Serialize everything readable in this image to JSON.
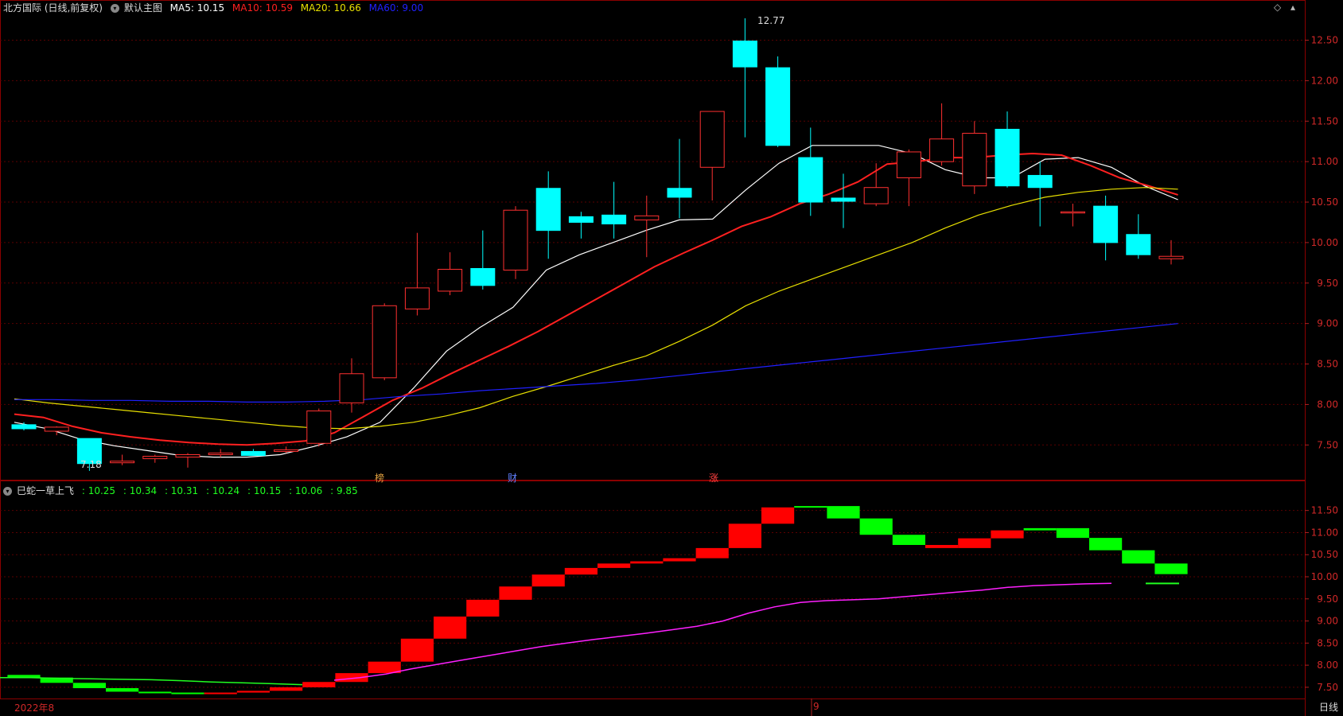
{
  "header": {
    "title": "北方国际 (日线,前复权)",
    "main_label": "默认主图",
    "ma5": "MA5: 10.15",
    "ma10": "MA10: 10.59",
    "ma20": "MA20: 10.66",
    "ma60": "MA60: 9.00",
    "colors": {
      "ma5": "#ffffff",
      "ma10": "#ff2020",
      "ma20": "#e8e000",
      "ma60": "#2020ff"
    }
  },
  "sub_header": {
    "name": "巳蛇一草上飞",
    "values": [
      ": 10.25",
      ": 10.34",
      ": 10.31",
      ": 10.24",
      ": 10.15",
      ": 10.06",
      ": 9.85"
    ]
  },
  "markers": {
    "high": "12.77",
    "low": "7.18",
    "tags": [
      "榜",
      "财",
      "涨"
    ]
  },
  "footer": {
    "date_start": "2022年8",
    "date_mid": "9",
    "period": "日线"
  },
  "chart_data": [
    {
      "type": "candlestick",
      "title": "北方国际 (日线,前复权)",
      "ylim": [
        7.1,
        12.8
      ],
      "yticks": [
        7.5,
        8.0,
        8.5,
        9.0,
        9.5,
        10.0,
        10.5,
        11.0,
        11.5,
        12.0,
        12.5
      ],
      "candles": [
        {
          "o": 7.75,
          "h": 7.78,
          "l": 7.68,
          "c": 7.7
        },
        {
          "o": 7.67,
          "h": 7.73,
          "l": 7.62,
          "c": 7.72
        },
        {
          "o": 7.58,
          "h": 7.58,
          "l": 7.18,
          "c": 7.27
        },
        {
          "o": 7.28,
          "h": 7.38,
          "l": 7.25,
          "c": 7.3
        },
        {
          "o": 7.33,
          "h": 7.38,
          "l": 7.28,
          "c": 7.36
        },
        {
          "o": 7.35,
          "h": 7.4,
          "l": 7.22,
          "c": 7.38
        },
        {
          "o": 7.38,
          "h": 7.45,
          "l": 7.35,
          "c": 7.4
        },
        {
          "o": 7.42,
          "h": 7.45,
          "l": 7.38,
          "c": 7.37
        },
        {
          "o": 7.42,
          "h": 7.48,
          "l": 7.4,
          "c": 7.44
        },
        {
          "o": 7.52,
          "h": 7.95,
          "l": 7.48,
          "c": 7.92
        },
        {
          "o": 8.02,
          "h": 8.57,
          "l": 7.9,
          "c": 8.38
        },
        {
          "o": 8.33,
          "h": 9.25,
          "l": 8.3,
          "c": 9.22
        },
        {
          "o": 9.18,
          "h": 10.12,
          "l": 9.1,
          "c": 9.44
        },
        {
          "o": 9.4,
          "h": 9.88,
          "l": 9.35,
          "c": 9.67
        },
        {
          "o": 9.68,
          "h": 10.15,
          "l": 9.42,
          "c": 9.47
        },
        {
          "o": 9.66,
          "h": 10.45,
          "l": 9.55,
          "c": 10.4
        },
        {
          "o": 10.67,
          "h": 10.88,
          "l": 9.8,
          "c": 10.15
        },
        {
          "o": 10.32,
          "h": 10.38,
          "l": 10.05,
          "c": 10.25
        },
        {
          "o": 10.34,
          "h": 10.75,
          "l": 10.05,
          "c": 10.23
        },
        {
          "o": 10.28,
          "h": 10.58,
          "l": 9.82,
          "c": 10.33
        },
        {
          "o": 10.67,
          "h": 11.28,
          "l": 10.3,
          "c": 10.56
        },
        {
          "o": 10.93,
          "h": 11.62,
          "l": 10.52,
          "c": 11.62
        },
        {
          "o": 12.49,
          "h": 12.77,
          "l": 11.3,
          "c": 12.17
        },
        {
          "o": 12.16,
          "h": 12.3,
          "l": 11.18,
          "c": 11.2
        },
        {
          "o": 11.05,
          "h": 11.42,
          "l": 10.33,
          "c": 10.5
        },
        {
          "o": 10.55,
          "h": 10.85,
          "l": 10.18,
          "c": 10.51
        },
        {
          "o": 10.48,
          "h": 10.98,
          "l": 10.45,
          "c": 10.68
        },
        {
          "o": 10.8,
          "h": 11.15,
          "l": 10.45,
          "c": 11.12
        },
        {
          "o": 11.0,
          "h": 11.72,
          "l": 10.95,
          "c": 11.28
        },
        {
          "o": 10.7,
          "h": 11.5,
          "l": 10.6,
          "c": 11.35
        },
        {
          "o": 11.4,
          "h": 11.62,
          "l": 10.68,
          "c": 10.7
        },
        {
          "o": 10.83,
          "h": 11.0,
          "l": 10.2,
          "c": 10.68
        },
        {
          "o": 10.38,
          "h": 10.48,
          "l": 10.2,
          "c": 10.38
        },
        {
          "o": 10.45,
          "h": 10.58,
          "l": 9.78,
          "c": 10.0
        },
        {
          "o": 10.1,
          "h": 10.35,
          "l": 9.8,
          "c": 9.85
        },
        {
          "o": 9.8,
          "h": 10.03,
          "l": 9.73,
          "c": 9.83
        }
      ],
      "series": [
        {
          "name": "MA5",
          "color": "#ffffff",
          "values": [
            7.78,
            7.7,
            7.57,
            7.49,
            7.43,
            7.37,
            7.35,
            7.35,
            7.38,
            7.48,
            7.6,
            7.78,
            8.2,
            8.66,
            8.95,
            9.2,
            9.66,
            9.85,
            10.0,
            10.15,
            10.28,
            10.29,
            10.65,
            10.98,
            11.2,
            11.2,
            11.2,
            11.1,
            10.9,
            10.8,
            10.8,
            11.03,
            11.05,
            10.93,
            10.7,
            10.53
          ]
        },
        {
          "name": "MA10",
          "color": "#ff2020",
          "values": [
            7.88,
            7.84,
            7.73,
            7.65,
            7.6,
            7.56,
            7.53,
            7.51,
            7.5,
            7.52,
            7.55,
            7.65,
            7.85,
            8.05,
            8.2,
            8.38,
            8.55,
            8.72,
            8.9,
            9.1,
            9.3,
            9.5,
            9.7,
            9.87,
            10.03,
            10.2,
            10.32,
            10.48,
            10.6,
            10.75,
            10.97,
            11.0,
            11.05,
            11.05,
            11.08,
            11.1,
            11.08,
            10.95,
            10.8,
            10.7,
            10.59
          ]
        },
        {
          "name": "MA20",
          "color": "#e8e000",
          "values": [
            8.07,
            8.02,
            7.98,
            7.94,
            7.9,
            7.86,
            7.82,
            7.78,
            7.74,
            7.71,
            7.7,
            7.73,
            7.78,
            7.86,
            7.96,
            8.1,
            8.22,
            8.35,
            8.48,
            8.6,
            8.78,
            8.98,
            9.22,
            9.4,
            9.55,
            9.7,
            9.85,
            10.0,
            10.18,
            10.34,
            10.46,
            10.56,
            10.62,
            10.66,
            10.68,
            10.66
          ]
        },
        {
          "name": "MA60",
          "color": "#2020ff",
          "values": [
            8.06,
            8.06,
            8.05,
            8.05,
            8.04,
            8.04,
            8.03,
            8.03,
            8.04,
            8.06,
            8.1,
            8.13,
            8.17,
            8.2,
            8.23,
            8.26,
            8.3,
            8.35,
            8.4,
            8.45,
            8.5,
            8.55,
            8.6,
            8.65,
            8.7,
            8.75,
            8.8,
            8.85,
            8.9,
            8.95,
            9.0
          ]
        }
      ]
    },
    {
      "type": "bar",
      "title": "巳蛇一草上飞",
      "ylim": [
        7.3,
        11.8
      ],
      "yticks": [
        7.5,
        8.0,
        8.5,
        9.0,
        9.5,
        10.0,
        10.5,
        11.0,
        11.5
      ],
      "steps": [
        {
          "a": 7.78,
          "b": 7.72,
          "up": false
        },
        {
          "a": 7.72,
          "b": 7.6,
          "up": false
        },
        {
          "a": 7.6,
          "b": 7.48,
          "up": false
        },
        {
          "a": 7.48,
          "b": 7.4,
          "up": false
        },
        {
          "a": 7.4,
          "b": 7.38,
          "up": false
        },
        {
          "a": 7.38,
          "b": 7.36,
          "up": false
        },
        {
          "a": 7.36,
          "b": 7.38,
          "up": true
        },
        {
          "a": 7.38,
          "b": 7.42,
          "up": true
        },
        {
          "a": 7.42,
          "b": 7.5,
          "up": true
        },
        {
          "a": 7.5,
          "b": 7.62,
          "up": true
        },
        {
          "a": 7.62,
          "b": 7.82,
          "up": true
        },
        {
          "a": 7.82,
          "b": 8.08,
          "up": true
        },
        {
          "a": 8.08,
          "b": 8.6,
          "up": true
        },
        {
          "a": 8.6,
          "b": 9.1,
          "up": true
        },
        {
          "a": 9.1,
          "b": 9.48,
          "up": true
        },
        {
          "a": 9.48,
          "b": 9.78,
          "up": true
        },
        {
          "a": 9.78,
          "b": 10.05,
          "up": true
        },
        {
          "a": 10.05,
          "b": 10.2,
          "up": true
        },
        {
          "a": 10.2,
          "b": 10.3,
          "up": true
        },
        {
          "a": 10.3,
          "b": 10.35,
          "up": true
        },
        {
          "a": 10.35,
          "b": 10.42,
          "up": true
        },
        {
          "a": 10.42,
          "b": 10.65,
          "up": true
        },
        {
          "a": 10.65,
          "b": 11.2,
          "up": true
        },
        {
          "a": 11.2,
          "b": 11.57,
          "up": true
        },
        {
          "a": 11.57,
          "b": 11.6,
          "up": false
        },
        {
          "a": 11.6,
          "b": 11.32,
          "up": false
        },
        {
          "a": 11.32,
          "b": 10.95,
          "up": false
        },
        {
          "a": 10.95,
          "b": 10.72,
          "up": false
        },
        {
          "a": 10.72,
          "b": 10.65,
          "up": true
        },
        {
          "a": 10.65,
          "b": 10.87,
          "up": true
        },
        {
          "a": 10.87,
          "b": 11.05,
          "up": true
        },
        {
          "a": 11.05,
          "b": 11.1,
          "up": false
        },
        {
          "a": 11.1,
          "b": 10.88,
          "up": false
        },
        {
          "a": 10.88,
          "b": 10.6,
          "up": false
        },
        {
          "a": 10.6,
          "b": 10.3,
          "up": false
        },
        {
          "a": 10.3,
          "b": 10.06,
          "up": false
        }
      ],
      "series": [
        {
          "name": "upper",
          "color": "#20ff20",
          "values": [
            7.72,
            7.72,
            7.7,
            7.69,
            7.68,
            7.67,
            7.65,
            7.62,
            7.6,
            7.58,
            7.56
          ]
        },
        {
          "name": "lower",
          "color": "#ff20ff",
          "values": [
            7.66,
            7.72,
            7.8,
            7.92,
            8.02,
            8.12,
            8.22,
            8.32,
            8.42,
            8.5,
            8.58,
            8.65,
            8.72,
            8.8,
            8.88,
            9.0,
            9.18,
            9.32,
            9.42,
            9.46,
            9.48,
            9.5,
            9.55,
            9.6,
            9.65,
            9.7,
            9.76,
            9.8,
            9.82,
            9.84,
            9.85
          ]
        }
      ]
    }
  ]
}
